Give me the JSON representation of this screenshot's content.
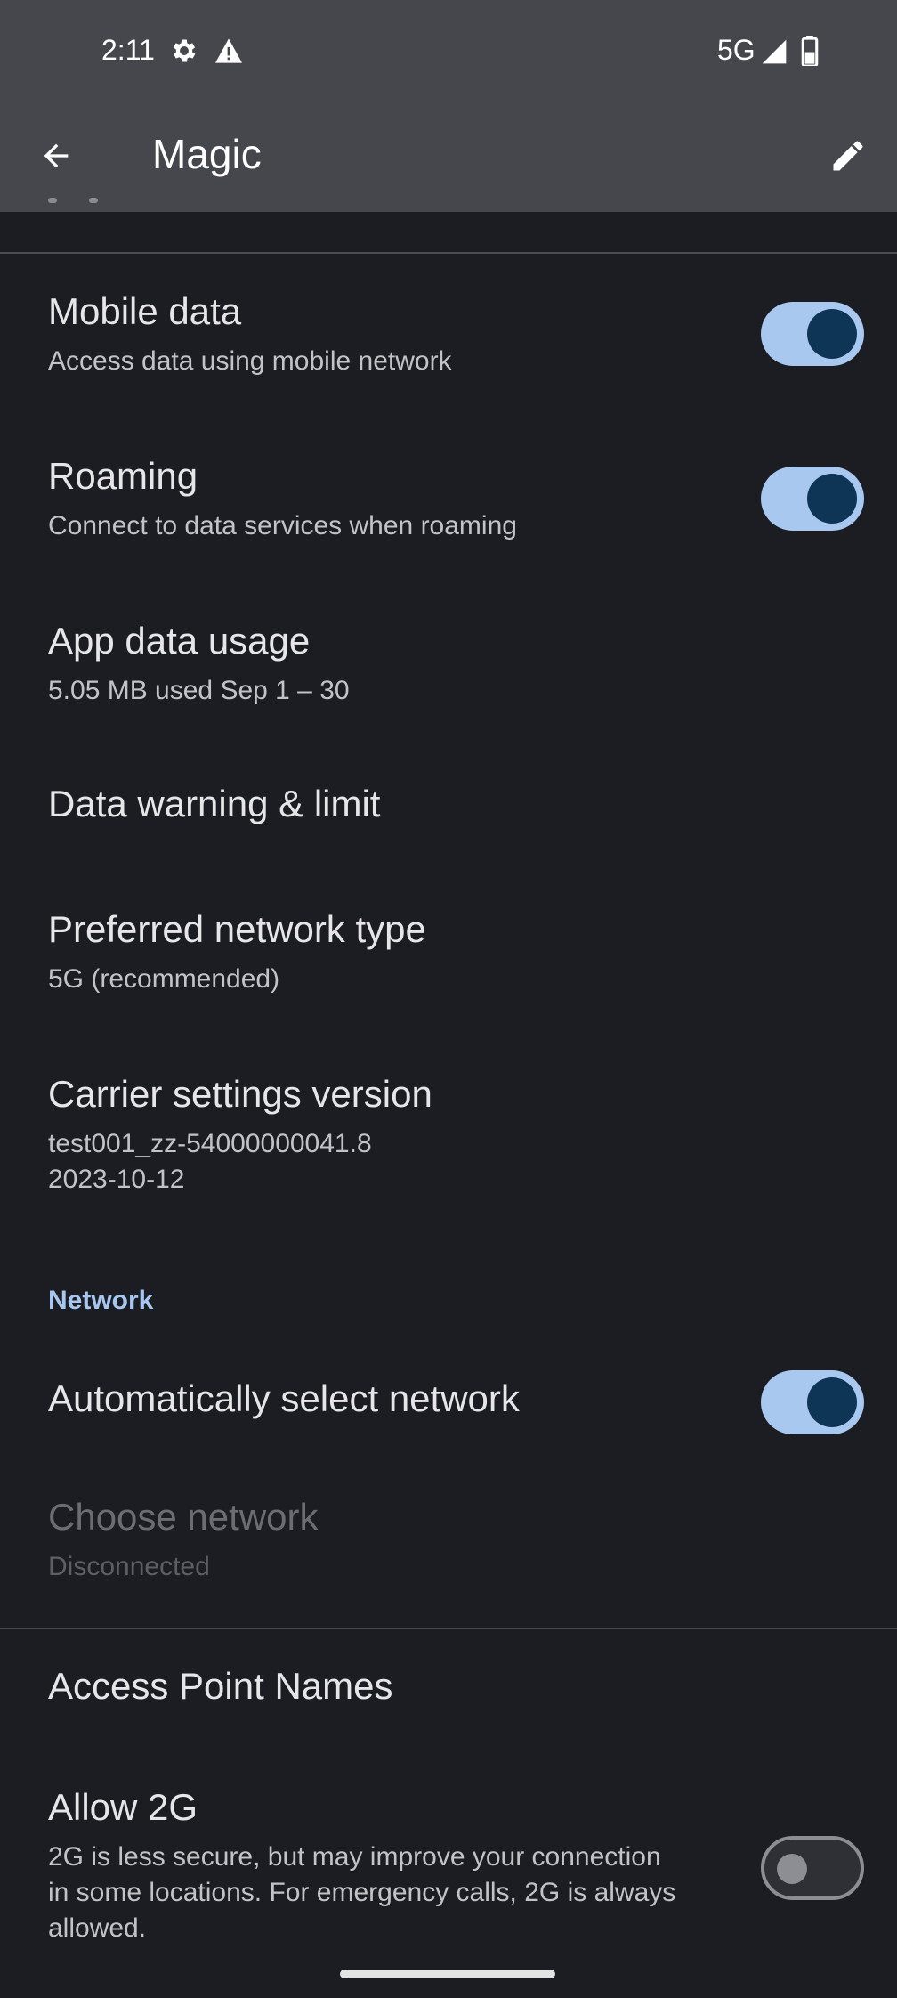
{
  "status_bar": {
    "time": "2:11",
    "network": "5G",
    "icons": [
      "gear-icon",
      "warning-icon",
      "signal-icon",
      "battery-icon"
    ]
  },
  "app_bar": {
    "title": "Magic",
    "back_icon": "arrow-back-icon",
    "edit_icon": "pencil-icon"
  },
  "settings": {
    "mobile_data": {
      "title": "Mobile data",
      "subtitle": "Access data using mobile network",
      "enabled": true
    },
    "roaming": {
      "title": "Roaming",
      "subtitle": "Connect to data services when roaming",
      "enabled": true
    },
    "app_data_usage": {
      "title": "App data usage",
      "subtitle": "5.05 MB used Sep 1 – 30"
    },
    "data_warning": {
      "title": "Data warning & limit"
    },
    "preferred_network": {
      "title": "Preferred network type",
      "subtitle": "5G (recommended)"
    },
    "carrier_settings": {
      "title": "Carrier settings version",
      "subtitle": "test001_zz-54000000041.8\n2023-10-12"
    },
    "network_section": {
      "header": "Network"
    },
    "auto_select": {
      "title": "Automatically select network",
      "enabled": true
    },
    "choose_network": {
      "title": "Choose network",
      "subtitle": "Disconnected"
    },
    "apn": {
      "title": "Access Point Names"
    },
    "allow_2g": {
      "title": "Allow 2G",
      "subtitle": "2G is less secure, but may improve your connection\nin some locations. For emergency calls, 2G is always\nallowed.",
      "enabled": false
    }
  },
  "colors": {
    "background": "#1b1d22",
    "topbar": "#45474c",
    "switch_on_track": "#a8c8f0",
    "switch_on_knob": "#0f3556",
    "section_header": "#a8c7f0"
  }
}
